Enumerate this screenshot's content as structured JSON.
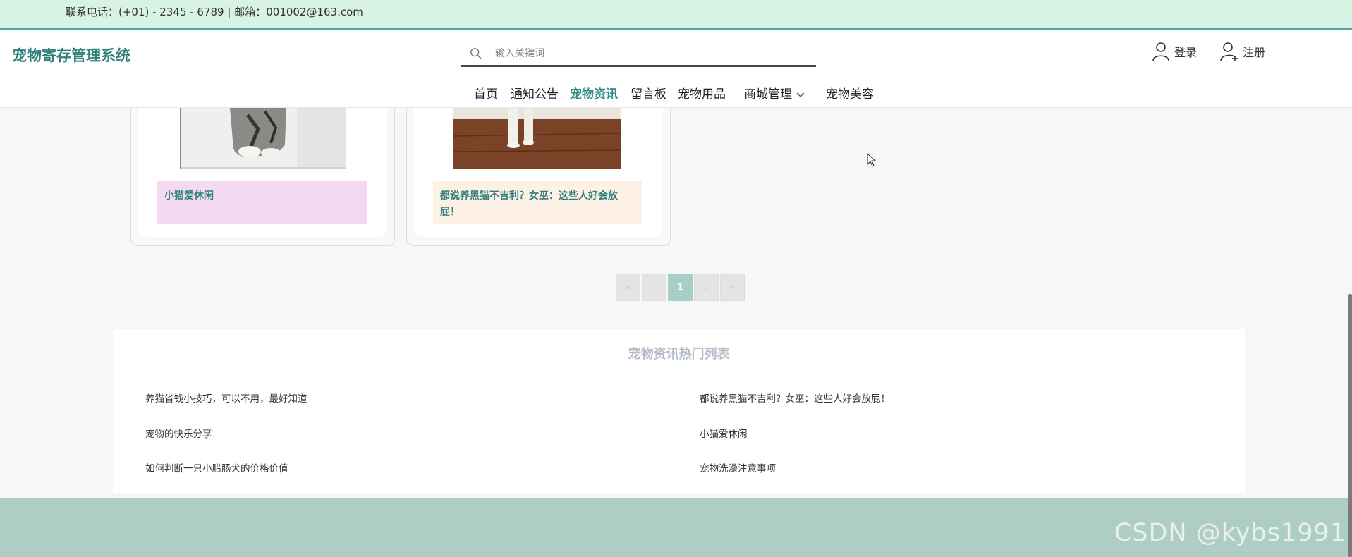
{
  "topbar": {
    "contact": "联系电话：(+01) - 2345 - 6789 | 邮箱：001002@163.com"
  },
  "header": {
    "site_title": "宠物寄存管理系统",
    "search": {
      "placeholder": "输入关键词",
      "value": ""
    },
    "login": "登录",
    "register": "注册"
  },
  "nav": {
    "items": [
      {
        "label": "首页"
      },
      {
        "label": "通知公告"
      },
      {
        "label": "宠物资讯"
      },
      {
        "label": "留言板"
      },
      {
        "label": "宠物用品"
      },
      {
        "label": "商城管理"
      },
      {
        "label": "宠物美容"
      }
    ],
    "active": "宠物资讯"
  },
  "cards": [
    {
      "title": "小猫爱休闲",
      "label_bg": "#f4d9f3"
    },
    {
      "title": "都说养黑猫不吉利？女巫：这些人好会放屁！",
      "label_bg": "#fdf1e5"
    }
  ],
  "pagination": {
    "first": "«",
    "prev": "‹",
    "current": "1",
    "next": "›",
    "last": "»"
  },
  "hot_list": {
    "title": "宠物资讯热门列表",
    "items": [
      "养猫省钱小技巧，可以不用，最好知道",
      "都说养黑猫不吉利？女巫：这些人好会放屁！",
      "宠物的快乐分享",
      "小猫爱休闲",
      "如何判断一只小腊肠犬的价格价值",
      "宠物洗澡注意事项"
    ]
  },
  "watermark": "CSDN @kybs1991",
  "colors": {
    "accent": "#2f8f86",
    "topbar_bg": "#d7f3e3",
    "footer_bg": "#aecdc4"
  }
}
